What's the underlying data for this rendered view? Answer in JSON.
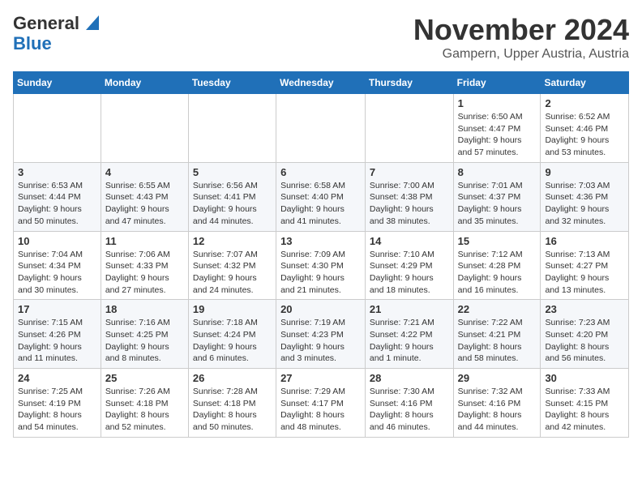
{
  "header": {
    "logo_line1": "General",
    "logo_line2": "Blue",
    "title": "November 2024",
    "subtitle": "Gampern, Upper Austria, Austria"
  },
  "calendar": {
    "weekdays": [
      "Sunday",
      "Monday",
      "Tuesday",
      "Wednesday",
      "Thursday",
      "Friday",
      "Saturday"
    ],
    "weeks": [
      [
        {
          "day": "",
          "info": ""
        },
        {
          "day": "",
          "info": ""
        },
        {
          "day": "",
          "info": ""
        },
        {
          "day": "",
          "info": ""
        },
        {
          "day": "",
          "info": ""
        },
        {
          "day": "1",
          "info": "Sunrise: 6:50 AM\nSunset: 4:47 PM\nDaylight: 9 hours\nand 57 minutes."
        },
        {
          "day": "2",
          "info": "Sunrise: 6:52 AM\nSunset: 4:46 PM\nDaylight: 9 hours\nand 53 minutes."
        }
      ],
      [
        {
          "day": "3",
          "info": "Sunrise: 6:53 AM\nSunset: 4:44 PM\nDaylight: 9 hours\nand 50 minutes."
        },
        {
          "day": "4",
          "info": "Sunrise: 6:55 AM\nSunset: 4:43 PM\nDaylight: 9 hours\nand 47 minutes."
        },
        {
          "day": "5",
          "info": "Sunrise: 6:56 AM\nSunset: 4:41 PM\nDaylight: 9 hours\nand 44 minutes."
        },
        {
          "day": "6",
          "info": "Sunrise: 6:58 AM\nSunset: 4:40 PM\nDaylight: 9 hours\nand 41 minutes."
        },
        {
          "day": "7",
          "info": "Sunrise: 7:00 AM\nSunset: 4:38 PM\nDaylight: 9 hours\nand 38 minutes."
        },
        {
          "day": "8",
          "info": "Sunrise: 7:01 AM\nSunset: 4:37 PM\nDaylight: 9 hours\nand 35 minutes."
        },
        {
          "day": "9",
          "info": "Sunrise: 7:03 AM\nSunset: 4:36 PM\nDaylight: 9 hours\nand 32 minutes."
        }
      ],
      [
        {
          "day": "10",
          "info": "Sunrise: 7:04 AM\nSunset: 4:34 PM\nDaylight: 9 hours\nand 30 minutes."
        },
        {
          "day": "11",
          "info": "Sunrise: 7:06 AM\nSunset: 4:33 PM\nDaylight: 9 hours\nand 27 minutes."
        },
        {
          "day": "12",
          "info": "Sunrise: 7:07 AM\nSunset: 4:32 PM\nDaylight: 9 hours\nand 24 minutes."
        },
        {
          "day": "13",
          "info": "Sunrise: 7:09 AM\nSunset: 4:30 PM\nDaylight: 9 hours\nand 21 minutes."
        },
        {
          "day": "14",
          "info": "Sunrise: 7:10 AM\nSunset: 4:29 PM\nDaylight: 9 hours\nand 18 minutes."
        },
        {
          "day": "15",
          "info": "Sunrise: 7:12 AM\nSunset: 4:28 PM\nDaylight: 9 hours\nand 16 minutes."
        },
        {
          "day": "16",
          "info": "Sunrise: 7:13 AM\nSunset: 4:27 PM\nDaylight: 9 hours\nand 13 minutes."
        }
      ],
      [
        {
          "day": "17",
          "info": "Sunrise: 7:15 AM\nSunset: 4:26 PM\nDaylight: 9 hours\nand 11 minutes."
        },
        {
          "day": "18",
          "info": "Sunrise: 7:16 AM\nSunset: 4:25 PM\nDaylight: 9 hours\nand 8 minutes."
        },
        {
          "day": "19",
          "info": "Sunrise: 7:18 AM\nSunset: 4:24 PM\nDaylight: 9 hours\nand 6 minutes."
        },
        {
          "day": "20",
          "info": "Sunrise: 7:19 AM\nSunset: 4:23 PM\nDaylight: 9 hours\nand 3 minutes."
        },
        {
          "day": "21",
          "info": "Sunrise: 7:21 AM\nSunset: 4:22 PM\nDaylight: 9 hours\nand 1 minute."
        },
        {
          "day": "22",
          "info": "Sunrise: 7:22 AM\nSunset: 4:21 PM\nDaylight: 8 hours\nand 58 minutes."
        },
        {
          "day": "23",
          "info": "Sunrise: 7:23 AM\nSunset: 4:20 PM\nDaylight: 8 hours\nand 56 minutes."
        }
      ],
      [
        {
          "day": "24",
          "info": "Sunrise: 7:25 AM\nSunset: 4:19 PM\nDaylight: 8 hours\nand 54 minutes."
        },
        {
          "day": "25",
          "info": "Sunrise: 7:26 AM\nSunset: 4:18 PM\nDaylight: 8 hours\nand 52 minutes."
        },
        {
          "day": "26",
          "info": "Sunrise: 7:28 AM\nSunset: 4:18 PM\nDaylight: 8 hours\nand 50 minutes."
        },
        {
          "day": "27",
          "info": "Sunrise: 7:29 AM\nSunset: 4:17 PM\nDaylight: 8 hours\nand 48 minutes."
        },
        {
          "day": "28",
          "info": "Sunrise: 7:30 AM\nSunset: 4:16 PM\nDaylight: 8 hours\nand 46 minutes."
        },
        {
          "day": "29",
          "info": "Sunrise: 7:32 AM\nSunset: 4:16 PM\nDaylight: 8 hours\nand 44 minutes."
        },
        {
          "day": "30",
          "info": "Sunrise: 7:33 AM\nSunset: 4:15 PM\nDaylight: 8 hours\nand 42 minutes."
        }
      ]
    ]
  }
}
